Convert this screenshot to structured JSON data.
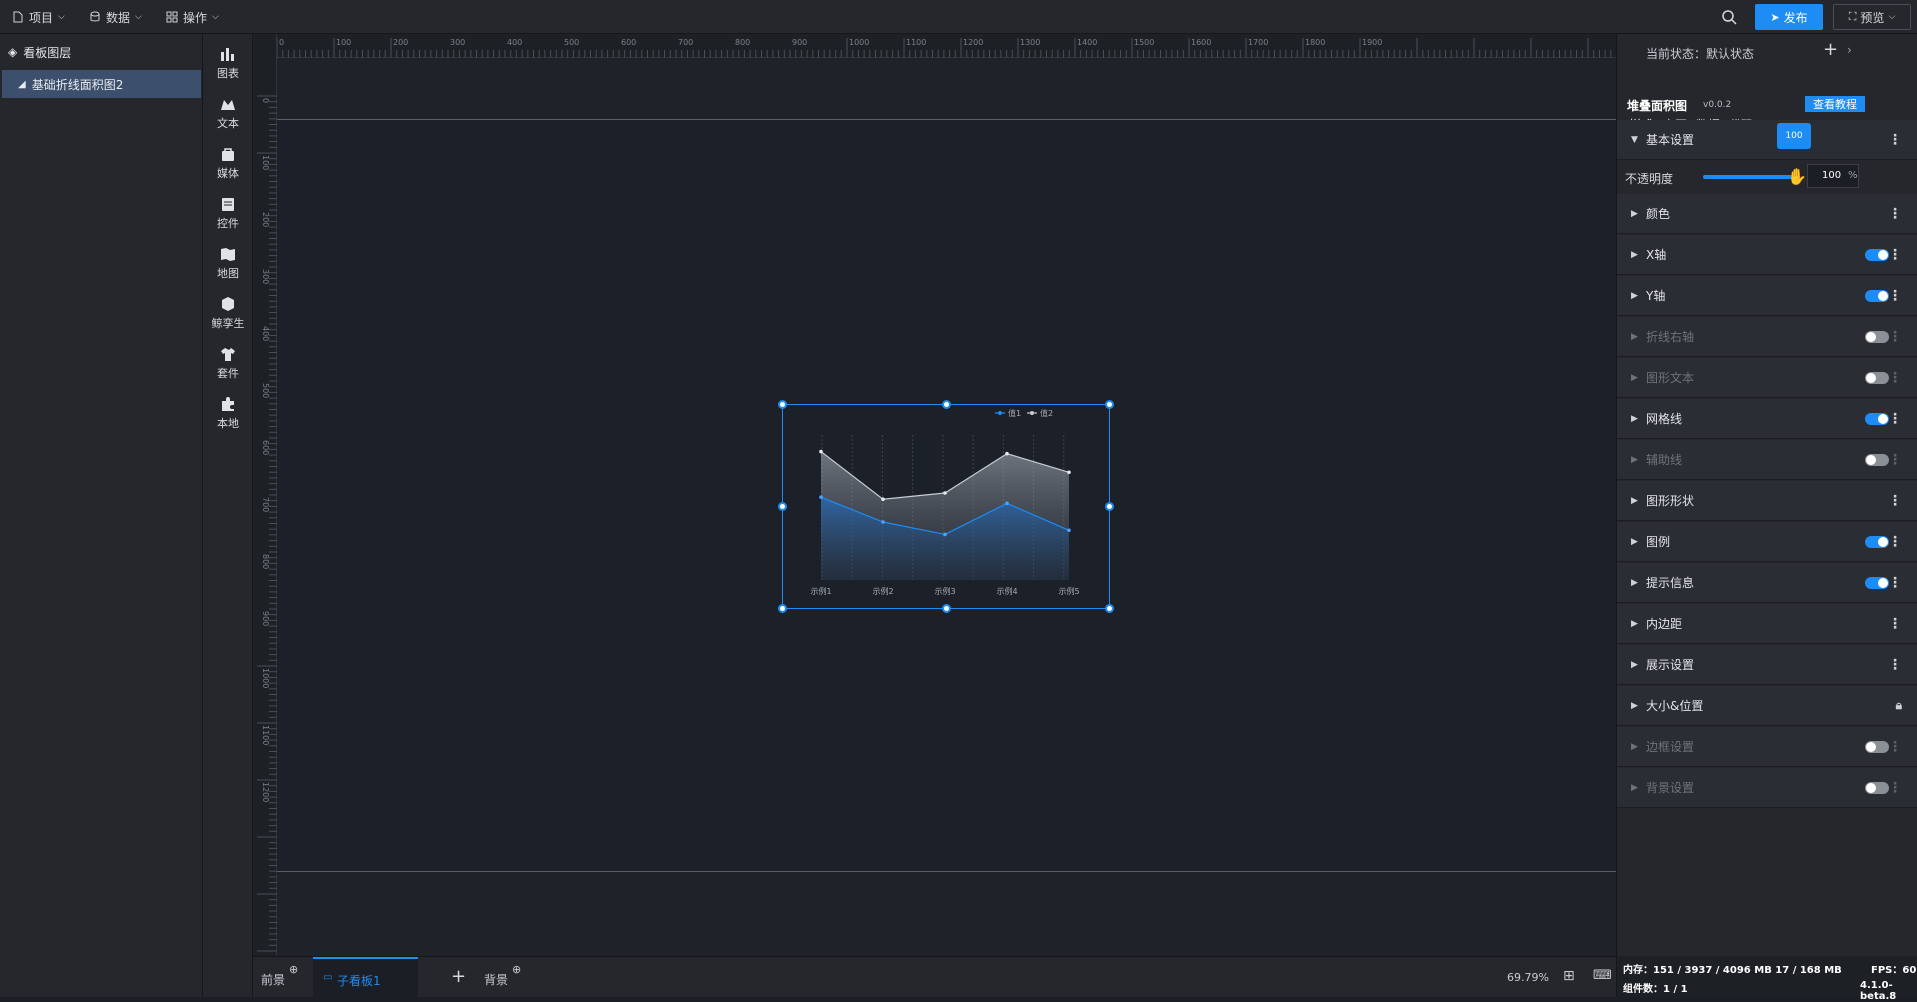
{
  "topbar": {
    "menus": [
      {
        "label": "项目",
        "icon": "file-icon"
      },
      {
        "label": "数据",
        "icon": "database-icon"
      },
      {
        "label": "操作",
        "icon": "grid-icon"
      }
    ],
    "publish": "发布",
    "preview": "预览"
  },
  "layers": {
    "title": "看板图层",
    "items": [
      "基础折线面积图2"
    ]
  },
  "components": [
    "图表",
    "文本",
    "媒体",
    "控件",
    "地图",
    "鲸孪生",
    "套件",
    "本地"
  ],
  "ruler": {
    "top": [
      "0",
      "100",
      "200",
      "300",
      "400",
      "500",
      "600",
      "700",
      "800",
      "900",
      "1000",
      "1100",
      "1200",
      "1300",
      "1400",
      "1500",
      "1600",
      "1700",
      "1800",
      "1900"
    ],
    "left": [
      "0",
      "100",
      "200",
      "300",
      "400",
      "500",
      "600",
      "700",
      "800",
      "900",
      "1000",
      "1100",
      "1200"
    ]
  },
  "chart_data": {
    "type": "area",
    "categories": [
      "示例1",
      "示例2",
      "示例3",
      "示例4",
      "示例5"
    ],
    "series": [
      {
        "name": "值1",
        "values": [
          40,
          28,
          22,
          37,
          24
        ],
        "color": "#1d8cf5"
      },
      {
        "name": "值2",
        "values": [
          62,
          39,
          42,
          61,
          52
        ],
        "color": "#c8ccd4"
      }
    ],
    "ylim": [
      0,
      70
    ],
    "grid": true,
    "legend": "top-right"
  },
  "bottom": {
    "tabs": [
      "前景",
      "子看板1",
      "背景"
    ],
    "zoom": "69.79%"
  },
  "props": {
    "state": "当前状态：默认状态",
    "tabs": [
      "样式",
      "交互",
      "数据",
      "代码"
    ],
    "component_name": "堆叠面积图",
    "version": "v0.0.2",
    "tutorial": "查看教程",
    "basic": "基本设置",
    "opacity_label": "不透明度",
    "opacity_value": "100",
    "opacity_tooltip": "100",
    "opacity_unit": "%",
    "opacity": 1.0,
    "sections": [
      {
        "label": "颜色",
        "toggle": "none",
        "dim": false
      },
      {
        "label": "X轴",
        "toggle": "on",
        "dim": false
      },
      {
        "label": "Y轴",
        "toggle": "on",
        "dim": false
      },
      {
        "label": "折线右轴",
        "toggle": "off",
        "dim": true
      },
      {
        "label": "图形文本",
        "toggle": "off",
        "dim": true
      },
      {
        "label": "网格线",
        "toggle": "on",
        "dim": false
      },
      {
        "label": "辅助线",
        "toggle": "off",
        "dim": true
      },
      {
        "label": "图形形状",
        "toggle": "none",
        "dim": false
      },
      {
        "label": "图例",
        "toggle": "on",
        "dim": false
      },
      {
        "label": "提示信息",
        "toggle": "on",
        "dim": false
      },
      {
        "label": "内边距",
        "toggle": "none",
        "dim": false
      },
      {
        "label": "展示设置",
        "toggle": "none",
        "dim": false
      },
      {
        "label": "大小&位置",
        "toggle": "lock",
        "dim": false
      },
      {
        "label": "边框设置",
        "toggle": "off",
        "dim": true
      },
      {
        "label": "背景设置",
        "toggle": "off",
        "dim": true
      }
    ]
  },
  "status": {
    "memory": "内存：151 / 3937 / 4096 MB  17 / 168 MB",
    "fps": "FPS：60",
    "count": "组件数：1 / 1",
    "version": "4.1.0-beta.8"
  }
}
